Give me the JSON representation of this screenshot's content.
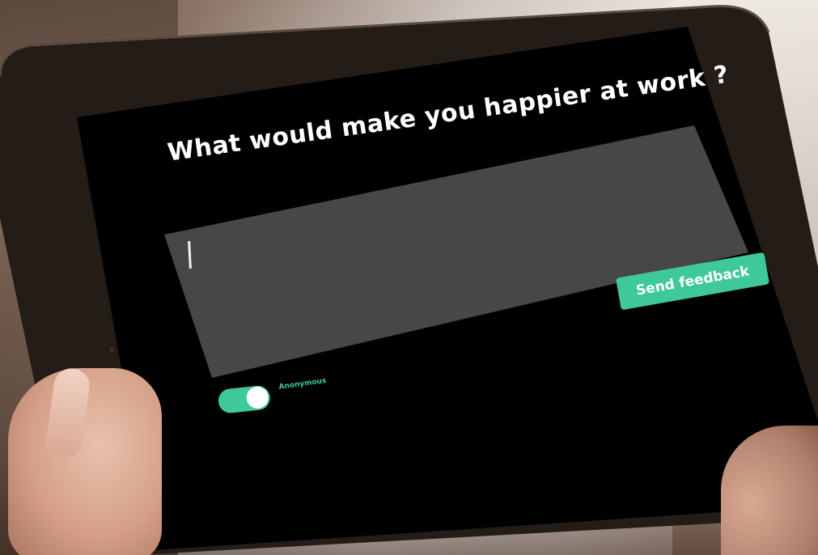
{
  "question": {
    "title": "What would make you happier at work ?"
  },
  "feedback": {
    "input_value": "",
    "send_label": "Send feedback"
  },
  "anonymous_toggle": {
    "label": "Anonymous",
    "state": "on"
  },
  "colors": {
    "accent": "#3fc99a",
    "screen_background": "#000000",
    "input_background": "#4a4a4a",
    "bezel": "#1a1512"
  }
}
